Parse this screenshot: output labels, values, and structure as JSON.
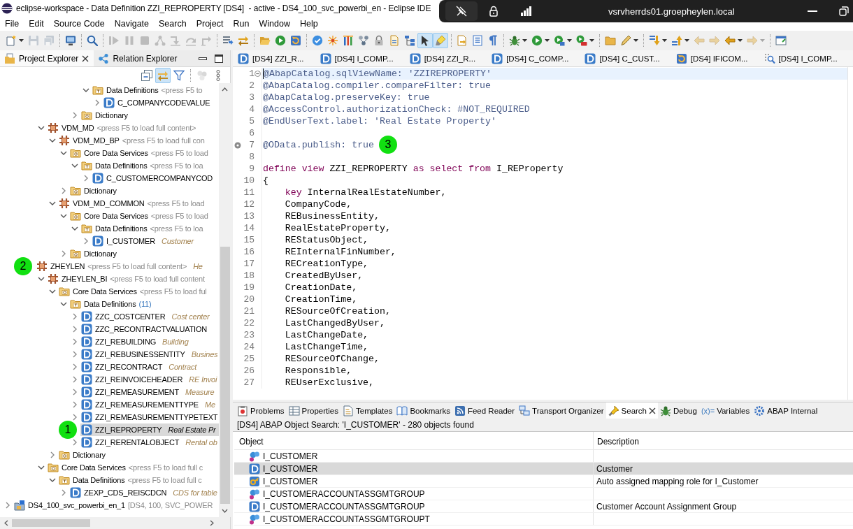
{
  "window": {
    "title": "eclipse-workspace - Data Definition ZZI_REPROPERTY [DS4]  - active - DS4_100_svc_powerbi_en - Eclipse IDE"
  },
  "remote_bar": {
    "host": "vsrvherrds01.groepheylen.local"
  },
  "menu": [
    "File",
    "Edit",
    "Source Code",
    "Navigate",
    "Search",
    "Project",
    "Run",
    "Window",
    "Help"
  ],
  "main_toolbar": {
    "buttons": [
      {
        "disabled": false,
        "pressed": false
      },
      {
        "disabled": true,
        "pressed": false
      },
      {
        "disabled": true,
        "pressed": false
      },
      {
        "disabled": false,
        "pressed": false
      },
      {
        "disabled": false,
        "pressed": false
      },
      {
        "disabled": true,
        "pressed": false
      },
      {
        "disabled": true,
        "pressed": false
      },
      {
        "disabled": true,
        "pressed": false
      },
      {
        "disabled": true,
        "pressed": false
      },
      {
        "disabled": true,
        "pressed": false
      },
      {
        "disabled": true,
        "pressed": false
      },
      {
        "disabled": true,
        "pressed": false
      },
      {
        "disabled": false,
        "pressed": false
      },
      {
        "disabled": false,
        "pressed": false
      },
      {
        "disabled": false,
        "pressed": false
      },
      {
        "disabled": false,
        "pressed": false
      },
      {
        "disabled": false,
        "pressed": false
      },
      {
        "disabled": false,
        "pressed": false
      },
      {
        "disabled": false,
        "pressed": false
      },
      {
        "disabled": false,
        "pressed": false
      },
      {
        "disabled": false,
        "pressed": false
      },
      {
        "disabled": false,
        "pressed": false
      },
      {
        "disabled": false,
        "pressed": false
      },
      {
        "disabled": false,
        "pressed": false
      },
      {
        "disabled": false,
        "pressed": true
      },
      {
        "disabled": false,
        "pressed": true
      },
      {
        "disabled": false,
        "pressed": false
      },
      {
        "disabled": false,
        "pressed": false
      },
      {
        "disabled": false,
        "pressed": false
      },
      {
        "disabled": false,
        "pressed": false
      },
      {
        "disabled": false,
        "pressed": false
      },
      {
        "disabled": false,
        "pressed": false
      },
      {
        "disabled": false,
        "pressed": false
      },
      {
        "disabled": false,
        "pressed": false
      },
      {
        "disabled": false,
        "pressed": false
      },
      {
        "disabled": false,
        "pressed": false
      },
      {
        "disabled": false,
        "pressed": false
      },
      {
        "disabled": true,
        "pressed": false
      },
      {
        "disabled": true,
        "pressed": false
      },
      {
        "disabled": false,
        "pressed": false
      },
      {
        "disabled": true,
        "pressed": false
      },
      {
        "disabled": false,
        "pressed": false
      }
    ]
  },
  "explorer": {
    "tabs": [
      {
        "label": "Project Explorer",
        "kind": "explorer",
        "selected": true,
        "closable": true
      },
      {
        "label": "Relation Explorer",
        "kind": "relations",
        "selected": false,
        "closable": false
      }
    ],
    "toolbar": {
      "buttons": [
        {
          "disabled": false,
          "pressed": false
        },
        {
          "disabled": false,
          "pressed": true
        },
        {
          "disabled": false,
          "pressed": false
        },
        {
          "disabled": true,
          "pressed": false
        },
        {
          "disabled": false,
          "pressed": false
        }
      ]
    },
    "tree": {
      "items": [
        {
          "children": [
            {
              "children": [
                {
                  "children": [
                    {
                      "children": [
                        {
                          "children": [
                            {
                              "children": [
                                {
                                  "children": [
                                    {
                                      "kind": "folder-t",
                                      "label": "Data Definitions",
                                      "hint": "<press F5 to",
                                      "expanded": true,
                                      "selected": false,
                                      "children": [
                                        {
                                          "kind": "ddl",
                                          "label": "C_COMPANYCODEVALUE",
                                          "expanded": false,
                                          "selected": false
                                        }
                                      ]
                                    }
                                  ]
                                },
                                {
                                  "kind": "folder-g",
                                  "label": "Dictionary",
                                  "expanded": false,
                                  "selected": false
                                }
                              ]
                            }
                          ]
                        }
                      ]
                    },
                    {
                      "kind": "package",
                      "label": "VDM_MD",
                      "hint": "<press F5 to load full content>",
                      "expanded": true,
                      "selected": false,
                      "children": [
                        {
                          "kind": "package",
                          "label": "VDM_MD_BP",
                          "hint": "<press F5 to load full con",
                          "expanded": true,
                          "selected": false,
                          "children": [
                            {
                              "kind": "folder-g",
                              "label": "Core Data Services",
                              "hint": "<press F5 to load",
                              "expanded": true,
                              "selected": false,
                              "children": [
                                {
                                  "kind": "folder-t",
                                  "label": "Data Definitions",
                                  "hint": "<press F5 to loa",
                                  "expanded": true,
                                  "selected": false,
                                  "children": [
                                    {
                                      "kind": "ddl",
                                      "label": "C_CUSTOMERCOMPANYCOD",
                                      "expanded": false,
                                      "selected": false
                                    }
                                  ]
                                }
                              ]
                            },
                            {
                              "kind": "folder-g",
                              "label": "Dictionary",
                              "expanded": false,
                              "selected": false
                            }
                          ]
                        },
                        {
                          "kind": "package",
                          "label": "VDM_MD_COMMON",
                          "hint": "<press F5 to load",
                          "expanded": true,
                          "selected": false,
                          "children": [
                            {
                              "kind": "folder-g",
                              "label": "Core Data Services",
                              "hint": "<press F5 to load",
                              "expanded": true,
                              "selected": false,
                              "children": [
                                {
                                  "kind": "folder-t",
                                  "label": "Data Definitions",
                                  "hint": "<press F5 to loa",
                                  "expanded": true,
                                  "selected": false,
                                  "children": [
                                    {
                                      "kind": "ddl",
                                      "label": "I_CUSTOMER",
                                      "description": "Customer",
                                      "expanded": false,
                                      "selected": false
                                    }
                                  ]
                                }
                              ]
                            },
                            {
                              "kind": "folder-g",
                              "label": "Dictionary",
                              "expanded": false,
                              "selected": false
                            }
                          ]
                        }
                      ]
                    }
                  ]
                },
                {
                  "kind": "package",
                  "label": "ZHEYLEN",
                  "hint": "<press F5 to load full content>",
                  "description": "He",
                  "badge": "2",
                  "selected": false,
                  "children": [
                    {
                      "kind": "package",
                      "label": "ZHEYLEN_BI",
                      "hint": "<press F5 to load full content",
                      "expanded": true,
                      "selected": false,
                      "children": [
                        {
                          "kind": "folder-g",
                          "label": "Core Data Services",
                          "hint": "<press F5 to load ful",
                          "expanded": true,
                          "selected": false,
                          "children": [
                            {
                              "kind": "folder-t",
                              "label": "Data Definitions",
                              "count": "(11)",
                              "expanded": true,
                              "selected": false,
                              "children": [
                                {
                                  "kind": "ddl",
                                  "label": "ZZC_COSTCENTER",
                                  "description": "Cost center",
                                  "expanded": false,
                                  "selected": false
                                },
                                {
                                  "kind": "ddl",
                                  "label": "ZZC_RECONTRACTVALUATION",
                                  "expanded": false,
                                  "selected": false
                                },
                                {
                                  "kind": "ddl",
                                  "label": "ZZI_REBUILDING",
                                  "description": "Building",
                                  "expanded": false,
                                  "selected": false
                                },
                                {
                                  "kind": "ddl",
                                  "label": "ZZI_REBUSINESSENTITY",
                                  "description": "Busines",
                                  "expanded": false,
                                  "selected": false
                                },
                                {
                                  "kind": "ddl",
                                  "label": "ZZI_RECONTRACT",
                                  "description": "Contract",
                                  "expanded": false,
                                  "selected": false
                                },
                                {
                                  "kind": "ddl",
                                  "label": "ZZI_REINVOICEHEADER",
                                  "description": "RE Invoi",
                                  "expanded": false,
                                  "selected": false
                                },
                                {
                                  "kind": "ddl",
                                  "label": "ZZI_REMEASUREMENT",
                                  "description": "Measure",
                                  "expanded": false,
                                  "selected": false
                                },
                                {
                                  "kind": "ddl",
                                  "label": "ZZI_REMEASUREMENTTYPE",
                                  "description": "Me",
                                  "expanded": false,
                                  "selected": false
                                },
                                {
                                  "kind": "ddl",
                                  "label": "ZZI_REMEASUREMENTTYPETEXT",
                                  "expanded": false,
                                  "selected": false
                                },
                                {
                                  "kind": "ddl",
                                  "label": "ZZI_REPROPERTY",
                                  "description": "Real Estate Pr",
                                  "badge": "1",
                                  "selected": true
                                },
                                {
                                  "kind": "ddl",
                                  "label": "ZZI_RERENTALOBJECT",
                                  "description": "Rental ob",
                                  "expanded": false,
                                  "selected": false
                                }
                              ]
                            }
                          ]
                        },
                        {
                          "kind": "folder-g",
                          "label": "Dictionary",
                          "expanded": false,
                          "selected": false
                        }
                      ]
                    },
                    {
                      "kind": "folder-g",
                      "label": "Core Data Services",
                      "hint": "<press F5 to load full c",
                      "expanded": true,
                      "selected": false,
                      "children": [
                        {
                          "kind": "folder-t",
                          "label": "Data Definitions",
                          "hint": "<press F5 to load full c",
                          "expanded": true,
                          "selected": false,
                          "children": [
                            {
                              "kind": "ddl",
                              "label": "ZEXP_CDS_REISCDCN",
                              "description": "CDS for table",
                              "expanded": false,
                              "selected": false
                            }
                          ]
                        }
                      ]
                    }
                  ]
                }
              ]
            }
          ]
        },
        {
          "kind": "project",
          "label": "DS4_100_svc_powerbi_en_1",
          "hint": "[DS4, 100, SVC_POWER",
          "expanded": false,
          "selected": false
        }
      ]
    }
  },
  "editor": {
    "tabs": [
      {
        "label": "[DS4] ZZI_R...",
        "kind": "ddl"
      },
      {
        "label": "[DS4] I_COMP...",
        "kind": "ddl"
      },
      {
        "label": "[DS4] ZZI_R...",
        "kind": "ddl"
      },
      {
        "label": "[DS4] C_COMP...",
        "kind": "ddl"
      },
      {
        "label": "[DS4] C_CUST...",
        "kind": "ddl"
      },
      {
        "label": "[DS4] IFICOM...",
        "kind": "refresh"
      },
      {
        "label": "[DS4] I_COMP...",
        "kind": "search"
      }
    ],
    "lines": [
      {
        "number": "1",
        "marker": false,
        "cursor": true,
        "fold": true,
        "indented": false,
        "tokens": [
          {
            "kind": "annotation",
            "text": "@AbapCatalog.sqlViewName: 'ZZIREPROPERTY'"
          }
        ]
      },
      {
        "number": "2",
        "marker": false,
        "cursor": false,
        "fold": false,
        "indented": false,
        "tokens": [
          {
            "kind": "annotation",
            "text": "@AbapCatalog.compiler.compareFilter: true"
          }
        ]
      },
      {
        "number": "3",
        "marker": false,
        "cursor": false,
        "fold": false,
        "indented": false,
        "tokens": [
          {
            "kind": "annotation",
            "text": "@AbapCatalog.preserveKey: true"
          }
        ]
      },
      {
        "number": "4",
        "marker": false,
        "cursor": false,
        "fold": false,
        "indented": false,
        "tokens": [
          {
            "kind": "annotation",
            "text": "@AccessControl.authorizationCheck: #NOT_REQUIRED"
          }
        ]
      },
      {
        "number": "5",
        "marker": false,
        "cursor": false,
        "fold": false,
        "indented": false,
        "tokens": [
          {
            "kind": "annotation",
            "text": "@EndUserText.label: 'Real Estate Property'"
          }
        ]
      },
      {
        "number": "6",
        "marker": false,
        "cursor": false,
        "fold": false
      },
      {
        "number": "7",
        "marker": true,
        "cursor": false,
        "fold": false,
        "indented": false,
        "badge": "3",
        "tokens": [
          {
            "kind": "annotation",
            "text": "@OData.publish: true"
          }
        ]
      },
      {
        "number": "8",
        "marker": false,
        "cursor": false,
        "fold": false
      },
      {
        "number": "9",
        "marker": false,
        "cursor": false,
        "fold": false,
        "indented": false,
        "tokens": [
          {
            "kind": "keyword",
            "text": "define view"
          },
          {
            "kind": "plain",
            "text": " ZZI_REPROPERTY "
          },
          {
            "kind": "keyword",
            "text": "as select from"
          },
          {
            "kind": "plain",
            "text": " I_REProperty"
          }
        ]
      },
      {
        "number": "10",
        "marker": false,
        "cursor": false,
        "fold": false,
        "indented": false,
        "tokens": [
          {
            "kind": "plain",
            "text": "{"
          }
        ]
      },
      {
        "number": "11",
        "marker": false,
        "cursor": false,
        "fold": false,
        "indented": true,
        "tokens": [
          {
            "kind": "keyword",
            "text": "key"
          },
          {
            "kind": "plain",
            "text": " InternalRealEstateNumber,"
          }
        ]
      },
      {
        "number": "12",
        "marker": false,
        "cursor": false,
        "fold": false,
        "indented": true,
        "tokens": [
          {
            "kind": "plain",
            "text": "CompanyCode,"
          }
        ]
      },
      {
        "number": "13",
        "marker": false,
        "cursor": false,
        "fold": false,
        "indented": true,
        "tokens": [
          {
            "kind": "plain",
            "text": "REBusinessEntity,"
          }
        ]
      },
      {
        "number": "14",
        "marker": false,
        "cursor": false,
        "fold": false,
        "indented": true,
        "tokens": [
          {
            "kind": "plain",
            "text": "RealEstateProperty,"
          }
        ]
      },
      {
        "number": "15",
        "marker": false,
        "cursor": false,
        "fold": false,
        "indented": true,
        "tokens": [
          {
            "kind": "plain",
            "text": "REStatusObject,"
          }
        ]
      },
      {
        "number": "16",
        "marker": false,
        "cursor": false,
        "fold": false,
        "indented": true,
        "tokens": [
          {
            "kind": "plain",
            "text": "REInternalFinNumber,"
          }
        ]
      },
      {
        "number": "17",
        "marker": false,
        "cursor": false,
        "fold": false,
        "indented": true,
        "tokens": [
          {
            "kind": "plain",
            "text": "RECreationType,"
          }
        ]
      },
      {
        "number": "18",
        "marker": false,
        "cursor": false,
        "fold": false,
        "indented": true,
        "tokens": [
          {
            "kind": "plain",
            "text": "CreatedByUser,"
          }
        ]
      },
      {
        "number": "19",
        "marker": false,
        "cursor": false,
        "fold": false,
        "indented": true,
        "tokens": [
          {
            "kind": "plain",
            "text": "CreationDate,"
          }
        ]
      },
      {
        "number": "20",
        "marker": false,
        "cursor": false,
        "fold": false,
        "indented": true,
        "tokens": [
          {
            "kind": "plain",
            "text": "CreationTime,"
          }
        ]
      },
      {
        "number": "21",
        "marker": false,
        "cursor": false,
        "fold": false,
        "indented": true,
        "tokens": [
          {
            "kind": "plain",
            "text": "RESourceOfCreation,"
          }
        ]
      },
      {
        "number": "22",
        "marker": false,
        "cursor": false,
        "fold": false,
        "indented": true,
        "tokens": [
          {
            "kind": "plain",
            "text": "LastChangedByUser,"
          }
        ]
      },
      {
        "number": "23",
        "marker": false,
        "cursor": false,
        "fold": false,
        "indented": true,
        "tokens": [
          {
            "kind": "plain",
            "text": "LastChangeDate,"
          }
        ]
      },
      {
        "number": "24",
        "marker": false,
        "cursor": false,
        "fold": false,
        "indented": true,
        "tokens": [
          {
            "kind": "plain",
            "text": "LastChangeTime,"
          }
        ]
      },
      {
        "number": "25",
        "marker": false,
        "cursor": false,
        "fold": false,
        "indented": true,
        "tokens": [
          {
            "kind": "plain",
            "text": "RESourceOfChange,"
          }
        ]
      },
      {
        "number": "26",
        "marker": false,
        "cursor": false,
        "fold": false,
        "indented": true,
        "tokens": [
          {
            "kind": "plain",
            "text": "Responsible,"
          }
        ]
      },
      {
        "number": "27",
        "marker": false,
        "cursor": false,
        "fold": false,
        "indented": true,
        "tokens": [
          {
            "kind": "plain",
            "text": "REUserExclusive,"
          }
        ]
      }
    ]
  },
  "bottom_panel": {
    "tabs": [
      {
        "label": "Problems",
        "kind": "problems",
        "selected": false,
        "closable": false
      },
      {
        "label": "Properties",
        "kind": "properties",
        "selected": false,
        "closable": false
      },
      {
        "label": "Templates",
        "kind": "templates",
        "selected": false,
        "closable": false
      },
      {
        "label": "Bookmarks",
        "kind": "bookmarks",
        "selected": false,
        "closable": false
      },
      {
        "label": "Feed Reader",
        "kind": "feed",
        "selected": false,
        "closable": false
      },
      {
        "label": "Transport Organizer",
        "kind": "transport",
        "selected": false,
        "closable": false
      },
      {
        "label": "Search",
        "kind": "search",
        "selected": true,
        "closable": true
      },
      {
        "label": "Debug",
        "kind": "debug",
        "selected": false,
        "closable": false
      },
      {
        "label": "Variables",
        "kind": "text",
        "icon_text": "(x)=",
        "selected": false,
        "closable": false
      },
      {
        "label": "ABAP Internal",
        "kind": "abap",
        "selected": false,
        "closable": false
      }
    ],
    "status": "[DS4] ABAP Object Search: 'I_CUSTOMER' - 280 objects found",
    "table": {
      "columns": [
        "Object",
        "Description"
      ],
      "rows": [
        {
          "kind": "entity",
          "object": "I_CUSTOMER",
          "selected": false
        },
        {
          "kind": "ddl",
          "object": "I_CUSTOMER",
          "description": "Customer",
          "selected": true
        },
        {
          "kind": "role",
          "object": "I_CUSTOMER",
          "description": "Auto assigned mapping role for I_Customer",
          "selected": false
        },
        {
          "kind": "entity",
          "object": "I_CUSTOMERACCOUNTASSGMTGROUP",
          "selected": false
        },
        {
          "kind": "ddl",
          "object": "I_CUSTOMERACCOUNTASSGMTGROUP",
          "description": "Customer Account Assignment Group",
          "selected": false
        },
        {
          "kind": "entity",
          "object": "I_CUSTOMERACCOUNTASSGMTGROUPT",
          "selected": false
        }
      ]
    }
  }
}
